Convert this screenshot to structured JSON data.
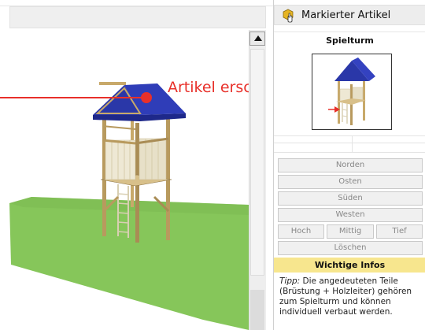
{
  "overlay": {
    "label": "Artikel erscheint hier",
    "color": "#e8302a"
  },
  "panel": {
    "header_title": "Markierter Artikel",
    "header_icon": "selected-item-hand-icon",
    "product_name": "Spielturm",
    "buttons": {
      "norden": "Norden",
      "osten": "Osten",
      "sueden": "Süden",
      "westen": "Westen",
      "hoch": "Hoch",
      "mittig": "Mittig",
      "tief": "Tief",
      "loeschen": "Löschen"
    },
    "info_header": "Wichtige Infos",
    "info_tip_label": "Tipp:",
    "info_text": " Die angedeuteten Teile (Brüstung + Holzleiter) gehören zum Spielturm und können individuell verbaut werden."
  },
  "colors": {
    "roof": "#2a37a8",
    "grass": "#86c65a",
    "wood": "#c8a96a",
    "info_bg": "#f7e68e"
  }
}
